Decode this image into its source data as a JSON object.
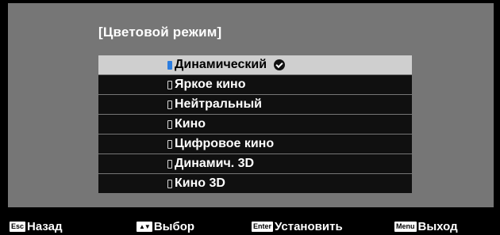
{
  "menu": {
    "title": "[Цветовой режим]",
    "options": [
      {
        "label": "Динамический",
        "selected": true
      },
      {
        "label": "Яркое кино",
        "selected": false
      },
      {
        "label": "Нейтральный",
        "selected": false
      },
      {
        "label": "Кино",
        "selected": false
      },
      {
        "label": "Цифровое кино",
        "selected": false
      },
      {
        "label": "Динамич. 3D",
        "selected": false
      },
      {
        "label": "Кино 3D",
        "selected": false
      }
    ]
  },
  "footer": {
    "back": {
      "key": "Esc",
      "label": "Назад"
    },
    "select": {
      "key": "▲▼",
      "label": "Выбор"
    },
    "set": {
      "key": "Enter",
      "label": "Установить"
    },
    "exit": {
      "key": "Menu",
      "label": "Выход"
    }
  },
  "colors": {
    "panel": "#767676",
    "highlight": "#cfcfcf",
    "radio_active": "#2b7de0"
  }
}
